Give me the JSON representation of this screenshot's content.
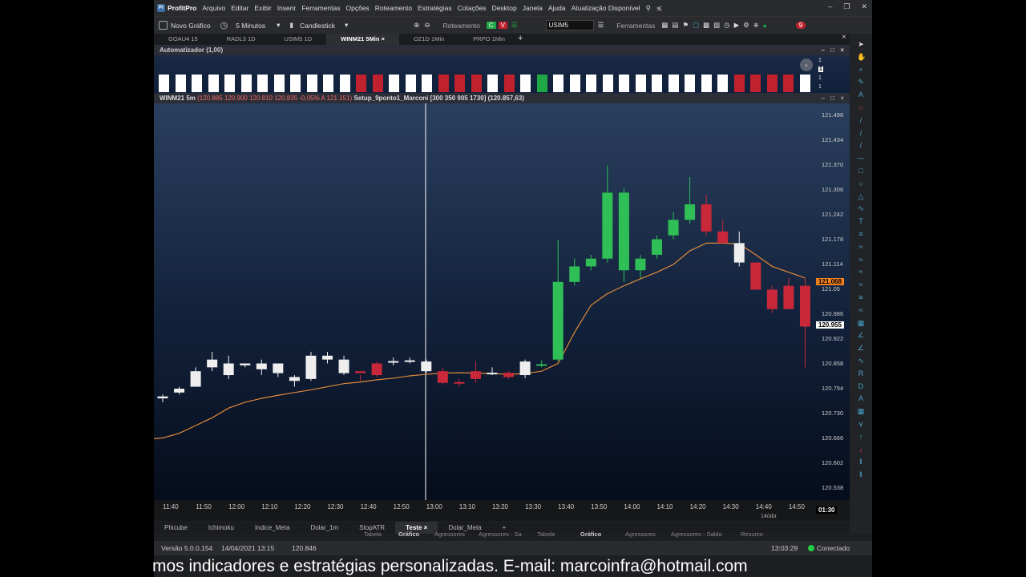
{
  "menubar": {
    "app_name": "ProfitPro",
    "items": [
      "Arquivo",
      "Editar",
      "Exibir",
      "Inserir",
      "Ferramentas",
      "Opções",
      "Roteamento",
      "Estratégias",
      "Cotações",
      "Desktop",
      "Janela",
      "Ajuda",
      "Atualização Disponível"
    ],
    "badge": "9"
  },
  "toolbar": {
    "new_chart": "Novo Gráfico",
    "interval": "5 Minutos",
    "chart_type": "Candlestick",
    "routing_label": "Roteamento",
    "buy_label": "C",
    "sell_label": "V",
    "symbol_value": "USIM5",
    "tools_label": "Ferramentas"
  },
  "tabs": [
    "GOAU4 15",
    "RADL3 1D",
    "USIM5 1D",
    "WINM21 5Min",
    "OZ1D 1Min",
    "PRPO 1Min"
  ],
  "active_tab_index": 3,
  "automatizador": {
    "title": "Automatizador (1,00)",
    "blocks": [
      "w",
      "w",
      "w",
      "w",
      "w",
      "w",
      "w",
      "w",
      "w",
      "w",
      "w",
      "w",
      "r",
      "r",
      "w",
      "w",
      "w",
      "r",
      "r",
      "r",
      "w",
      "r",
      "w",
      "g",
      "w",
      "w",
      "w",
      "w",
      "w",
      "w",
      "w",
      "w",
      "w",
      "w",
      "w",
      "r",
      "r",
      "r",
      "r",
      "w"
    ],
    "colors": {
      "w": "#ffffff",
      "r": "#c0212e",
      "g": "#1fa845"
    },
    "axis_labels": [
      "1",
      "1",
      "1",
      "1"
    ]
  },
  "chart_header": {
    "symbol": "WINM21 5m",
    "ohlc": "(120.885  120.900  120.810  120.835  -0,05%  A 121.151)",
    "indicator": "Setup_9ponto1_Marconi [300 350 905 1730] (120.857,63)"
  },
  "chart_data": {
    "type": "candlestick",
    "x": [
      "11:40",
      "11:45",
      "11:50",
      "11:55",
      "12:00",
      "12:05",
      "12:10",
      "12:15",
      "12:20",
      "12:25",
      "12:30",
      "12:35",
      "12:40",
      "12:45",
      "12:50",
      "12:55",
      "13:00",
      "13:05",
      "13:10",
      "13:15",
      "13:20",
      "13:25",
      "13:30",
      "13:35",
      "13:40",
      "13:45",
      "13:50",
      "13:55",
      "14:00",
      "14:05",
      "14:10",
      "14:15",
      "14:20",
      "14:25",
      "14:30",
      "14:35",
      "14:40",
      "14:45",
      "14:50",
      "14:55"
    ],
    "ohlc": [
      {
        "o": 120.77,
        "h": 120.78,
        "l": 120.76,
        "c": 120.775,
        "col": "w"
      },
      {
        "o": 120.785,
        "h": 120.8,
        "l": 120.78,
        "c": 120.795,
        "col": "w"
      },
      {
        "o": 120.8,
        "h": 120.85,
        "l": 120.8,
        "c": 120.84,
        "col": "w"
      },
      {
        "o": 120.85,
        "h": 120.89,
        "l": 120.84,
        "c": 120.87,
        "col": "w"
      },
      {
        "o": 120.83,
        "h": 120.88,
        "l": 120.82,
        "c": 120.86,
        "col": "w"
      },
      {
        "o": 120.855,
        "h": 120.86,
        "l": 120.85,
        "c": 120.86,
        "col": "w"
      },
      {
        "o": 120.845,
        "h": 120.87,
        "l": 120.83,
        "c": 120.86,
        "col": "w"
      },
      {
        "o": 120.835,
        "h": 120.86,
        "l": 120.825,
        "c": 120.86,
        "col": "w"
      },
      {
        "o": 120.815,
        "h": 120.83,
        "l": 120.8,
        "c": 120.825,
        "col": "w"
      },
      {
        "o": 120.82,
        "h": 120.89,
        "l": 120.815,
        "c": 120.88,
        "col": "w"
      },
      {
        "o": 120.87,
        "h": 120.89,
        "l": 120.86,
        "c": 120.88,
        "col": "w"
      },
      {
        "o": 120.835,
        "h": 120.88,
        "l": 120.83,
        "c": 120.87,
        "col": "w"
      },
      {
        "o": 120.84,
        "h": 120.83,
        "l": 120.815,
        "c": 120.835,
        "col": "r"
      },
      {
        "o": 120.86,
        "h": 120.865,
        "l": 120.825,
        "c": 120.83,
        "col": "r"
      },
      {
        "o": 120.866,
        "h": 120.875,
        "l": 120.855,
        "c": 120.866,
        "col": "w"
      },
      {
        "o": 120.868,
        "h": 120.875,
        "l": 120.86,
        "c": 120.868,
        "col": "w"
      },
      {
        "o": 120.84,
        "h": 120.87,
        "l": 120.835,
        "c": 120.865,
        "col": "w"
      },
      {
        "o": 120.84,
        "h": 120.85,
        "l": 120.805,
        "c": 120.81,
        "col": "r"
      },
      {
        "o": 120.812,
        "h": 120.82,
        "l": 120.8,
        "c": 120.81,
        "col": "r"
      },
      {
        "o": 120.84,
        "h": 120.866,
        "l": 120.81,
        "c": 120.82,
        "col": "r"
      },
      {
        "o": 120.836,
        "h": 120.85,
        "l": 120.83,
        "c": 120.836,
        "col": "w"
      },
      {
        "o": 120.836,
        "h": 120.84,
        "l": 120.82,
        "c": 120.825,
        "col": "r"
      },
      {
        "o": 120.83,
        "h": 120.87,
        "l": 120.822,
        "c": 120.865,
        "col": "w"
      },
      {
        "o": 120.855,
        "h": 120.868,
        "l": 120.85,
        "c": 120.858,
        "col": "g"
      },
      {
        "o": 120.87,
        "h": 121.178,
        "l": 120.865,
        "c": 121.07,
        "col": "g"
      },
      {
        "o": 121.07,
        "h": 121.13,
        "l": 121.06,
        "c": 121.11,
        "col": "g"
      },
      {
        "o": 121.11,
        "h": 121.14,
        "l": 121.1,
        "c": 121.13,
        "col": "g"
      },
      {
        "o": 121.13,
        "h": 121.37,
        "l": 121.12,
        "c": 121.3,
        "col": "g"
      },
      {
        "o": 121.1,
        "h": 121.31,
        "l": 121.07,
        "c": 121.3,
        "col": "g"
      },
      {
        "o": 121.1,
        "h": 121.14,
        "l": 121.08,
        "c": 121.13,
        "col": "g"
      },
      {
        "o": 121.14,
        "h": 121.19,
        "l": 121.13,
        "c": 121.18,
        "col": "g"
      },
      {
        "o": 121.19,
        "h": 121.25,
        "l": 121.18,
        "c": 121.23,
        "col": "g"
      },
      {
        "o": 121.23,
        "h": 121.34,
        "l": 121.22,
        "c": 121.27,
        "col": "g"
      },
      {
        "o": 121.27,
        "h": 121.295,
        "l": 121.19,
        "c": 121.2,
        "col": "r"
      },
      {
        "o": 121.2,
        "h": 121.23,
        "l": 121.17,
        "c": 121.17,
        "col": "r"
      },
      {
        "o": 121.17,
        "h": 121.2,
        "l": 121.11,
        "c": 121.12,
        "col": "w"
      },
      {
        "o": 121.12,
        "h": 121.12,
        "l": 121.05,
        "c": 121.05,
        "col": "r"
      },
      {
        "o": 121.05,
        "h": 121.06,
        "l": 120.99,
        "c": 121.0,
        "col": "r"
      },
      {
        "o": 121.06,
        "h": 121.08,
        "l": 121.0,
        "c": 121.0,
        "col": "r"
      },
      {
        "o": 121.06,
        "h": 121.08,
        "l": 120.85,
        "c": 120.955,
        "col": "r"
      }
    ],
    "series": [
      {
        "values": [
          120.668,
          120.68,
          120.7,
          120.72,
          120.745,
          120.76,
          120.77,
          120.778,
          120.785,
          120.792,
          120.8,
          120.808,
          120.812,
          120.818,
          120.822,
          120.828,
          120.832,
          120.835,
          120.836,
          120.835,
          120.834,
          120.832,
          120.834,
          120.84,
          120.86,
          120.94,
          121.01,
          121.04,
          121.06,
          121.078,
          121.095,
          121.115,
          121.15,
          121.17,
          121.17,
          121.168,
          121.14,
          121.11,
          121.095,
          121.08
        ]
      }
    ],
    "ylim": [
      120.508,
      121.53
    ],
    "y_ticks": [
      "121.498",
      "121.434",
      "121.370",
      "121.306",
      "121.242",
      "121.178",
      "121.114",
      "121.05",
      "120.986",
      "120.922",
      "120.858",
      "120.794",
      "120.730",
      "120.666",
      "120.602",
      "120.538"
    ],
    "x_ticks": [
      "11:40",
      "11:50",
      "12:00",
      "12:10",
      "12:20",
      "12:30",
      "12:40",
      "12:50",
      "13:00",
      "13:10",
      "13:20",
      "13:30",
      "13:40",
      "13:50",
      "14:00",
      "14:10",
      "14:20",
      "14:30",
      "14:40",
      "14:50"
    ],
    "price_tags": [
      {
        "label": "121.068",
        "value": 121.068,
        "color": "#f0801e",
        "text": "#000"
      },
      {
        "label": "120.955",
        "value": 120.955,
        "color": "#ffffff",
        "text": "#000"
      }
    ],
    "crosshair_time_label": "01:30",
    "date_label": "14/abr",
    "candle_colors": {
      "w": "#eeeeee",
      "r": "#c8283a",
      "g": "#2fbf56"
    },
    "ma_color": "#e0893b"
  },
  "bottom_tabs": [
    "Phicube",
    "Ichimoku",
    "Indice_Meta",
    "Dolar_1m",
    "StopATR",
    "Teste",
    "Dolar_Meta"
  ],
  "active_bottom_tab_index": 5,
  "ghost_tabs": [
    "Tabela",
    "Gráfico",
    "Agressores",
    "Agressores - Sa",
    "Tabela",
    "Gráfico",
    "Agressores",
    "Agressores - Saldo",
    "Resumo"
  ],
  "status": {
    "version": "Versão 5.0.0.154",
    "datetime": "14/04/2021 13:15",
    "price": "120.846",
    "clock": "13:03:29",
    "connection": "Conectado"
  },
  "caption": "mos indicadores e estratégias personalizadas. E-mail: marcoinfra@hotmail.com"
}
